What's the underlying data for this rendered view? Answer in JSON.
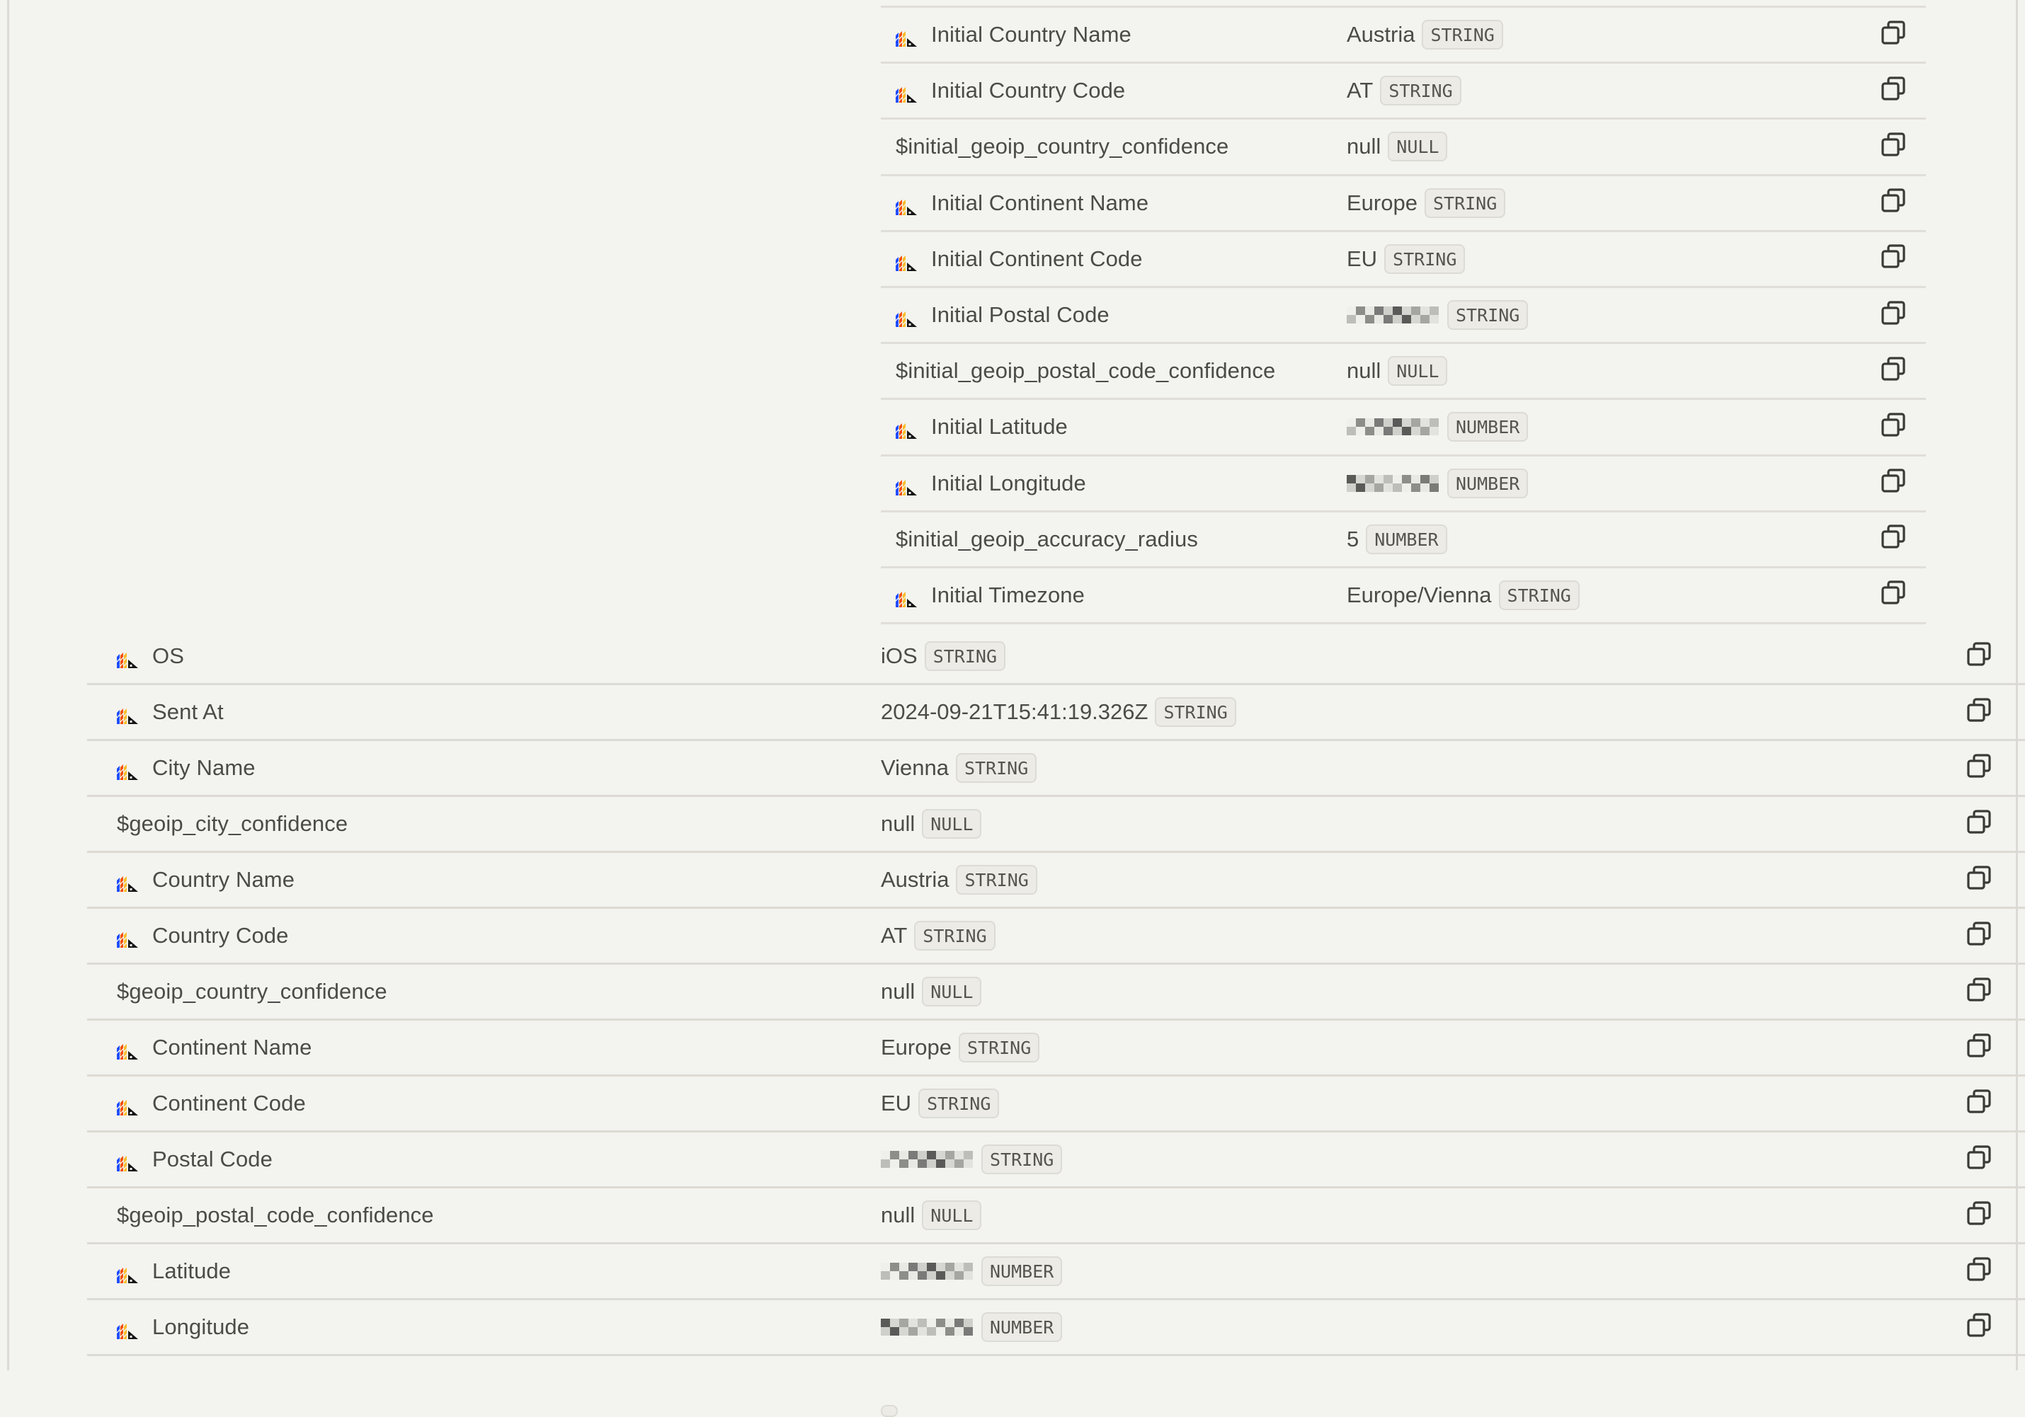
{
  "nested_properties": [
    {
      "key": "Initial Country Name",
      "posthog_icon": true,
      "value": "Austria",
      "type": "STRING"
    },
    {
      "key": "Initial Country Code",
      "posthog_icon": true,
      "value": "AT",
      "type": "STRING"
    },
    {
      "key": "$initial_geoip_country_confidence",
      "posthog_icon": false,
      "value": "null",
      "type": "NULL"
    },
    {
      "key": "Initial Continent Name",
      "posthog_icon": true,
      "value": "Europe",
      "type": "STRING"
    },
    {
      "key": "Initial Continent Code",
      "posthog_icon": true,
      "value": "EU",
      "type": "STRING"
    },
    {
      "key": "Initial Postal Code",
      "posthog_icon": true,
      "value": "[redacted]",
      "redacted": true,
      "type": "STRING"
    },
    {
      "key": "$initial_geoip_postal_code_confidence",
      "posthog_icon": false,
      "value": "null",
      "type": "NULL"
    },
    {
      "key": "Initial Latitude",
      "posthog_icon": true,
      "value": "[redacted]",
      "redacted": true,
      "type": "NUMBER"
    },
    {
      "key": "Initial Longitude",
      "posthog_icon": true,
      "value": "[redacted]",
      "redacted": true,
      "type": "NUMBER"
    },
    {
      "key": "$initial_geoip_accuracy_radius",
      "posthog_icon": false,
      "value": "5",
      "type": "NUMBER"
    },
    {
      "key": "Initial Timezone",
      "posthog_icon": true,
      "value": "Europe/Vienna",
      "type": "STRING"
    }
  ],
  "properties": [
    {
      "key": "OS",
      "posthog_icon": true,
      "value": "iOS",
      "type": "STRING"
    },
    {
      "key": "Sent At",
      "posthog_icon": true,
      "value": "2024-09-21T15:41:19.326Z",
      "type": "STRING"
    },
    {
      "key": "City Name",
      "posthog_icon": true,
      "value": "Vienna",
      "type": "STRING"
    },
    {
      "key": "$geoip_city_confidence",
      "posthog_icon": false,
      "value": "null",
      "type": "NULL"
    },
    {
      "key": "Country Name",
      "posthog_icon": true,
      "value": "Austria",
      "type": "STRING"
    },
    {
      "key": "Country Code",
      "posthog_icon": true,
      "value": "AT",
      "type": "STRING"
    },
    {
      "key": "$geoip_country_confidence",
      "posthog_icon": false,
      "value": "null",
      "type": "NULL"
    },
    {
      "key": "Continent Name",
      "posthog_icon": true,
      "value": "Europe",
      "type": "STRING"
    },
    {
      "key": "Continent Code",
      "posthog_icon": true,
      "value": "EU",
      "type": "STRING"
    },
    {
      "key": "Postal Code",
      "posthog_icon": true,
      "value": "[redacted]",
      "redacted": true,
      "type": "STRING"
    },
    {
      "key": "$geoip_postal_code_confidence",
      "posthog_icon": false,
      "value": "null",
      "type": "NULL"
    },
    {
      "key": "Latitude",
      "posthog_icon": true,
      "value": "[redacted]",
      "redacted": true,
      "type": "NUMBER"
    },
    {
      "key": "Longitude",
      "posthog_icon": true,
      "value": "[redacted]",
      "redacted": true,
      "type": "NUMBER"
    },
    {
      "key": "",
      "posthog_icon": false,
      "value": "",
      "type": "",
      "partial": true
    }
  ],
  "icons": {
    "property_source": "posthog-logo-icon",
    "row_action": "copy-icon"
  },
  "colors": {
    "background": "#f3f3ef",
    "text": "#4b4b48",
    "badge_bg": "#ecebe6",
    "badge_border": "#dcdbd5",
    "divider": "#e0ded8",
    "posthog_blue": "#1d4aff",
    "posthog_orange": "#f54e00",
    "posthog_yellow": "#f9bd2b"
  }
}
